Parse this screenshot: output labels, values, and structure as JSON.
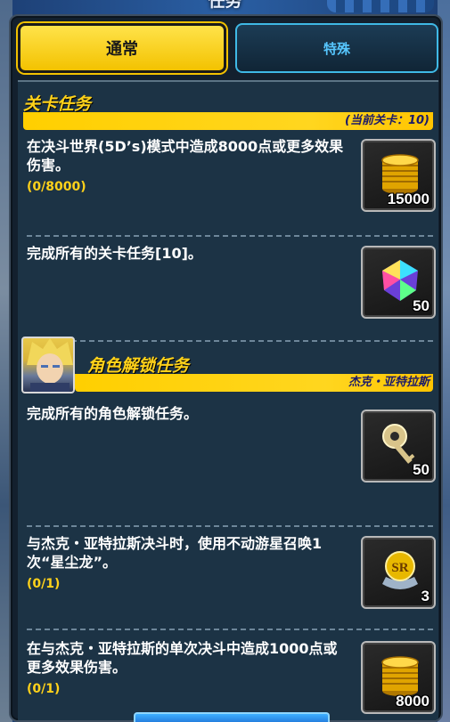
{
  "header": {
    "title": "任务"
  },
  "tabs": [
    {
      "label": "通常",
      "active": true
    },
    {
      "label": "特殊",
      "active": false
    }
  ],
  "sections": [
    {
      "title": "关卡任务",
      "subtitle": "(当前关卡：10)",
      "missions": [
        {
          "text": "在决斗世界(5D’s)模式中造成8000点或更多效果伤害。",
          "progress": "(0/8000)",
          "reward_icon": "gold-coins-icon",
          "reward_count": "15000"
        },
        {
          "text": "完成所有的关卡任务[10]。",
          "progress": "",
          "reward_icon": "gem-icon",
          "reward_count": "50"
        }
      ]
    },
    {
      "title": "角色解锁任务",
      "subtitle": "杰克・亚特拉斯",
      "missions": [
        {
          "text": "完成所有的角色解锁任务。",
          "progress": "",
          "reward_icon": "key-icon",
          "reward_count": "50"
        },
        {
          "text": "与杰克・亚特拉斯决斗时，使用不动游星召唤1次“星尘龙”。",
          "progress": "(0/1)",
          "reward_icon": "sr-ticket-icon",
          "reward_count": "3"
        },
        {
          "text": "在与杰克・亚特拉斯的单次决斗中造成1000点或更多效果伤害。",
          "progress": "(0/1)",
          "reward_icon": "gold-coins-icon",
          "reward_count": "8000"
        }
      ]
    }
  ],
  "colors": {
    "accent": "#ffd21a",
    "panel": "#1c3345",
    "tab_special": "#57c7ff"
  }
}
